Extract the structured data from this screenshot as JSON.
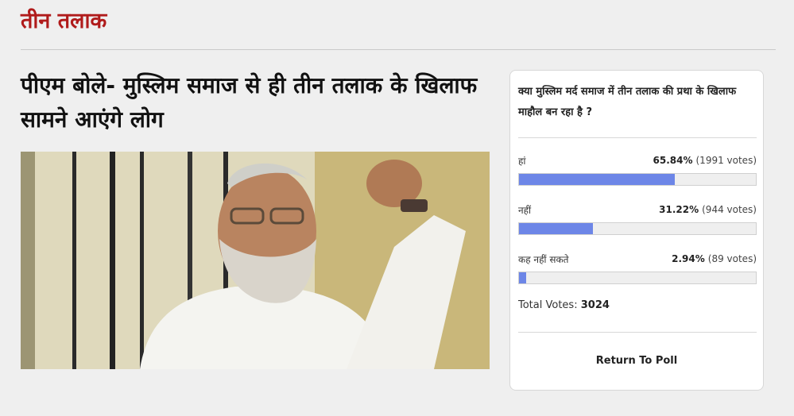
{
  "section": {
    "title": "तीन तलाक"
  },
  "article": {
    "headline": "पीएम बोले- मुस्लिम समाज से ही तीन तलाक के खिलाफ सामने आएंगे लोग"
  },
  "poll": {
    "question": "क्या मुस्लिम मर्द समाज में तीन तलाक की प्रथा के खिलाफ माहौल बन रहा है ?",
    "options": [
      {
        "label": "हां",
        "percent": "65.84%",
        "votes": "(1991 votes)",
        "fraction": 0.6584
      },
      {
        "label": "नहीं",
        "percent": "31.22%",
        "votes": "(944 votes)",
        "fraction": 0.3122
      },
      {
        "label": "कह नहीं सकते",
        "percent": "2.94%",
        "votes": "(89 votes)",
        "fraction": 0.0294
      }
    ],
    "total_label": "Total Votes:",
    "total_value": "3024",
    "return_label": "Return To Poll"
  },
  "colors": {
    "accent": "#b01b1b",
    "bar": "#6d86e7"
  }
}
